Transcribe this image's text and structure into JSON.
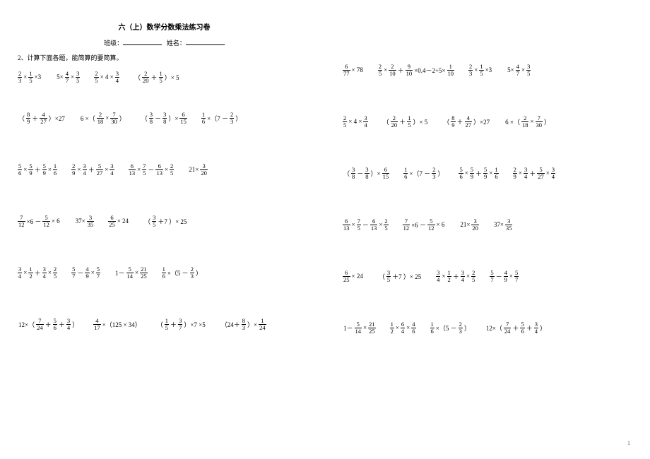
{
  "title": "六（上）数学分数乘法练习卷",
  "class_label": "班级：",
  "name_label": "姓名：",
  "instruction": "2、计算下面各题，能简算的要简算。",
  "page_number": "1",
  "left_rows": [
    [
      [
        [
          "f",
          "2",
          "3"
        ],
        "×",
        [
          "f",
          "1",
          "5"
        ],
        "×3"
      ],
      [
        "5×",
        [
          "f",
          "4",
          "7"
        ],
        "×",
        [
          "f",
          "3",
          "5"
        ]
      ],
      [
        [
          "f",
          "2",
          "5"
        ],
        "× 4 × ",
        [
          "f",
          "3",
          "4"
        ]
      ],
      [
        "（",
        [
          "f",
          "2",
          "20"
        ],
        "＋",
        [
          "f",
          "1",
          "5"
        ],
        "）× 5"
      ]
    ],
    [
      [
        "（",
        [
          "f",
          "8",
          "9"
        ],
        "＋",
        [
          "f",
          "4",
          "27"
        ],
        "）×27"
      ],
      [
        "6 ×（",
        [
          "f",
          "2",
          "18"
        ],
        "×",
        [
          "f",
          "7",
          "30"
        ],
        "）"
      ],
      [
        "（",
        [
          "f",
          "3",
          "8"
        ],
        "－",
        [
          "f",
          "3",
          "8"
        ],
        "）× ",
        [
          "f",
          "6",
          "15"
        ]
      ],
      [
        [
          "f",
          "1",
          "6"
        ],
        "×（7 － ",
        [
          "f",
          "2",
          "3"
        ],
        "）"
      ]
    ],
    [
      [
        [
          "f",
          "5",
          "6"
        ],
        "×",
        [
          "f",
          "5",
          "9"
        ],
        "＋",
        [
          "f",
          "5",
          "9"
        ],
        "× ",
        [
          "f",
          "1",
          "6"
        ]
      ],
      [
        [
          "f",
          "2",
          "9"
        ],
        "×",
        [
          "f",
          "3",
          "4"
        ],
        "＋",
        [
          "f",
          "5",
          "27"
        ],
        "× ",
        [
          "f",
          "3",
          "4"
        ]
      ],
      [
        [
          "f",
          "6",
          "13"
        ],
        "×",
        [
          "f",
          "7",
          "5"
        ],
        "－",
        [
          "f",
          "6",
          "13"
        ],
        "× ",
        [
          "f",
          "2",
          "5"
        ]
      ],
      [
        "21× ",
        [
          "f",
          "3",
          "20"
        ]
      ]
    ],
    [
      [
        [
          "f",
          "7",
          "12"
        ],
        "×6 － ",
        [
          "f",
          "5",
          "12"
        ],
        "× 6"
      ],
      [
        "37× ",
        [
          "f",
          "3",
          "35"
        ]
      ],
      [
        [
          "f",
          "6",
          "25"
        ],
        " × 24"
      ],
      [
        "（",
        [
          "f",
          "3",
          "5"
        ],
        "＋7 ）× 25"
      ]
    ],
    [
      [
        [
          "f",
          "3",
          "4"
        ],
        "×",
        [
          "f",
          "1",
          "2"
        ],
        "＋",
        [
          "f",
          "3",
          "4"
        ],
        "× ",
        [
          "f",
          "2",
          "5"
        ]
      ],
      [
        [
          "f",
          "5",
          "7"
        ],
        "－ ",
        [
          "f",
          "4",
          "9"
        ],
        "× ",
        [
          "f",
          "5",
          "7"
        ]
      ],
      [
        "1－ ",
        [
          "f",
          "5",
          "14"
        ],
        "× ",
        [
          "f",
          "21",
          "25"
        ]
      ],
      [
        [
          "f",
          "1",
          "6"
        ],
        "×（5 － ",
        [
          "f",
          "2",
          "3"
        ],
        "）"
      ]
    ],
    [
      [
        "12×（",
        [
          "f",
          "7",
          "24"
        ],
        "＋",
        [
          "f",
          "5",
          "6"
        ],
        "＋",
        [
          "f",
          "3",
          "4"
        ],
        "）"
      ],
      [
        [
          "f",
          "4",
          "17"
        ],
        "×（125 × 34）"
      ],
      [
        "（",
        [
          "f",
          "1",
          "5"
        ],
        "＋",
        [
          "f",
          "3",
          "7"
        ],
        "）×7 ×5"
      ],
      [
        "（24＋",
        [
          "f",
          "8",
          "3"
        ],
        "）× ",
        [
          "f",
          "1",
          "24"
        ]
      ]
    ]
  ],
  "right_rows": [
    [
      [
        [
          "f",
          "6",
          "77"
        ],
        " × 78"
      ],
      [
        [
          "f",
          "2",
          "5"
        ],
        "×",
        [
          "f",
          "2",
          "10"
        ],
        "＋",
        [
          "f",
          "9",
          "10"
        ],
        "×0.4－2÷5×",
        [
          "f",
          "1",
          "10"
        ]
      ],
      [
        [
          "f",
          "2",
          "3"
        ],
        "×",
        [
          "f",
          "1",
          "5"
        ],
        "×3"
      ],
      [
        "5×",
        [
          "f",
          "4",
          "7"
        ],
        "×",
        [
          "f",
          "3",
          "5"
        ]
      ]
    ],
    [
      [
        [
          "f",
          "2",
          "5"
        ],
        "× 4 × ",
        [
          "f",
          "3",
          "4"
        ]
      ],
      [
        "（",
        [
          "f",
          "2",
          "20"
        ],
        "＋",
        [
          "f",
          "1",
          "5"
        ],
        "）× 5"
      ],
      [
        "（",
        [
          "f",
          "8",
          "9"
        ],
        "＋",
        [
          "f",
          "4",
          "27"
        ],
        "）×27"
      ],
      [
        "6 ×（",
        [
          "f",
          "2",
          "18"
        ],
        "×",
        [
          "f",
          "7",
          "30"
        ],
        "）"
      ]
    ],
    [
      [
        "（",
        [
          "f",
          "3",
          "8"
        ],
        "－",
        [
          "f",
          "3",
          "8"
        ],
        "）× ",
        [
          "f",
          "6",
          "15"
        ]
      ],
      [
        [
          "f",
          "1",
          "6"
        ],
        "×（7 － ",
        [
          "f",
          "2",
          "3"
        ],
        "）"
      ],
      [
        [
          "f",
          "5",
          "6"
        ],
        "×",
        [
          "f",
          "5",
          "9"
        ],
        "＋",
        [
          "f",
          "5",
          "9"
        ],
        "× ",
        [
          "f",
          "1",
          "6"
        ]
      ],
      [
        [
          "f",
          "2",
          "9"
        ],
        "×",
        [
          "f",
          "3",
          "4"
        ],
        "＋",
        [
          "f",
          "5",
          "27"
        ],
        "× ",
        [
          "f",
          "3",
          "4"
        ]
      ]
    ],
    [
      [
        [
          "f",
          "6",
          "13"
        ],
        "×",
        [
          "f",
          "7",
          "5"
        ],
        "－",
        [
          "f",
          "6",
          "13"
        ],
        "× ",
        [
          "f",
          "2",
          "5"
        ]
      ],
      [
        [
          "f",
          "7",
          "12"
        ],
        "×6 － ",
        [
          "f",
          "5",
          "12"
        ],
        "× 6"
      ],
      [
        "21× ",
        [
          "f",
          "3",
          "20"
        ]
      ],
      [
        "37× ",
        [
          "f",
          "3",
          "35"
        ]
      ]
    ],
    [
      [
        [
          "f",
          "6",
          "25"
        ],
        " × 24"
      ],
      [
        "（",
        [
          "f",
          "3",
          "5"
        ],
        "＋7 ）× 25"
      ],
      [
        [
          "f",
          "3",
          "4"
        ],
        "×",
        [
          "f",
          "1",
          "2"
        ],
        "＋",
        [
          "f",
          "3",
          "4"
        ],
        "× ",
        [
          "f",
          "2",
          "5"
        ]
      ],
      [
        [
          "f",
          "5",
          "7"
        ],
        "－ ",
        [
          "f",
          "4",
          "9"
        ],
        "× ",
        [
          "f",
          "5",
          "7"
        ]
      ]
    ],
    [
      [
        "1－ ",
        [
          "f",
          "5",
          "14"
        ],
        "× ",
        [
          "f",
          "21",
          "25"
        ]
      ],
      [
        [
          "f",
          "1",
          "2"
        ],
        "×",
        [
          "f",
          "6",
          "4"
        ],
        "× ",
        [
          "f",
          "4",
          "6"
        ]
      ],
      [
        [
          "f",
          "1",
          "6"
        ],
        "×（5 － ",
        [
          "f",
          "2",
          "3"
        ],
        "）"
      ],
      [
        "12×（",
        [
          "f",
          "7",
          "24"
        ],
        "＋",
        [
          "f",
          "5",
          "6"
        ],
        "＋",
        [
          "f",
          "3",
          "4"
        ],
        "）"
      ]
    ]
  ]
}
